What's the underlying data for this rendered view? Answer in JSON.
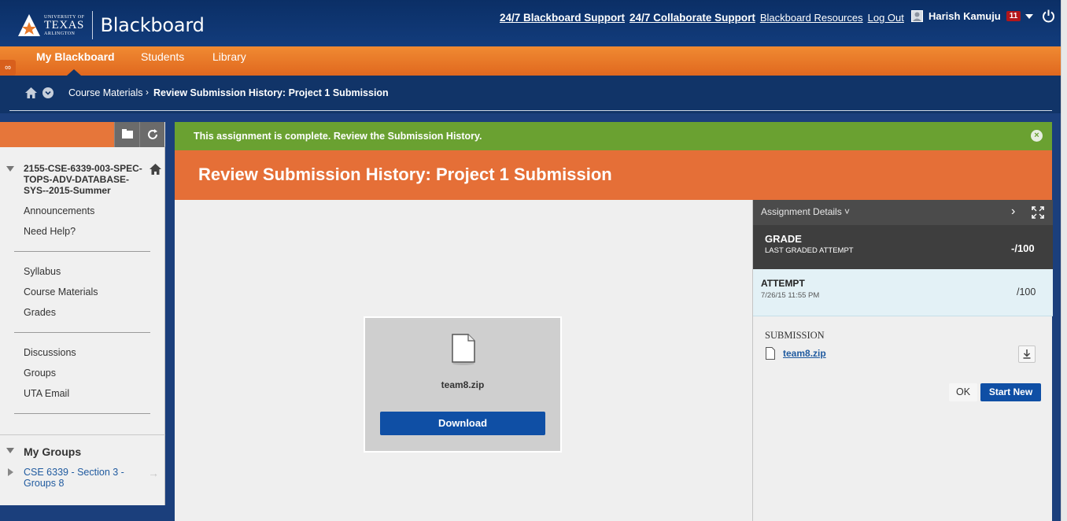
{
  "header": {
    "logo_small": "UNIVERSITY OF",
    "logo_big": "TEXAS",
    "logo_small2": "ARLINGTON",
    "app_name": "Blackboard",
    "links": [
      {
        "label": "24/7 Blackboard Support",
        "bold": true
      },
      {
        "label": "24/7 Collaborate Support",
        "bold": true
      },
      {
        "label": "Blackboard Resources",
        "bold": false
      },
      {
        "label": "Log Out",
        "bold": false
      }
    ],
    "user_name": "Harish Kamuju",
    "notification_count": "11"
  },
  "nav": {
    "tabs": [
      "My Blackboard",
      "Students",
      "Library"
    ],
    "active": "My Blackboard"
  },
  "breadcrumb": {
    "parent": "Course Materials",
    "current": "Review Submission History: Project 1 Submission"
  },
  "sidebar": {
    "course_title": "2155-CSE-6339-003-SPEC-TOPS-ADV-DATABASE-SYS--2015-Summer",
    "group1": [
      "Announcements",
      "Need Help?"
    ],
    "group2": [
      "Syllabus",
      "Course Materials",
      "Grades"
    ],
    "group3": [
      "Discussions",
      "Groups",
      "UTA Email"
    ],
    "my_groups_title": "My Groups",
    "my_groups_item": "CSE 6339 - Section 3 - Groups 8"
  },
  "main": {
    "banner": "This assignment is complete. Review the Submission History.",
    "title": "Review Submission History: Project 1 Submission",
    "file_name": "team8.zip",
    "download_label": "Download"
  },
  "panel": {
    "header": "Assignment Details",
    "grade_label": "GRADE",
    "grade_sub": "LAST GRADED ATTEMPT",
    "grade_value": "-/100",
    "attempt_label": "ATTEMPT",
    "attempt_date": "7/26/15 11:55 PM",
    "attempt_value": "/100",
    "submission_label": "SUBMISSION",
    "submission_file": "team8.zip",
    "ok_label": "OK",
    "start_new_label": "Start New"
  },
  "colors": {
    "header_blue": "#0b2f66",
    "nav_orange": "#e97a2a",
    "banner_green": "#6aa131",
    "title_orange": "#e56f37",
    "button_blue": "#0f4fa5"
  }
}
